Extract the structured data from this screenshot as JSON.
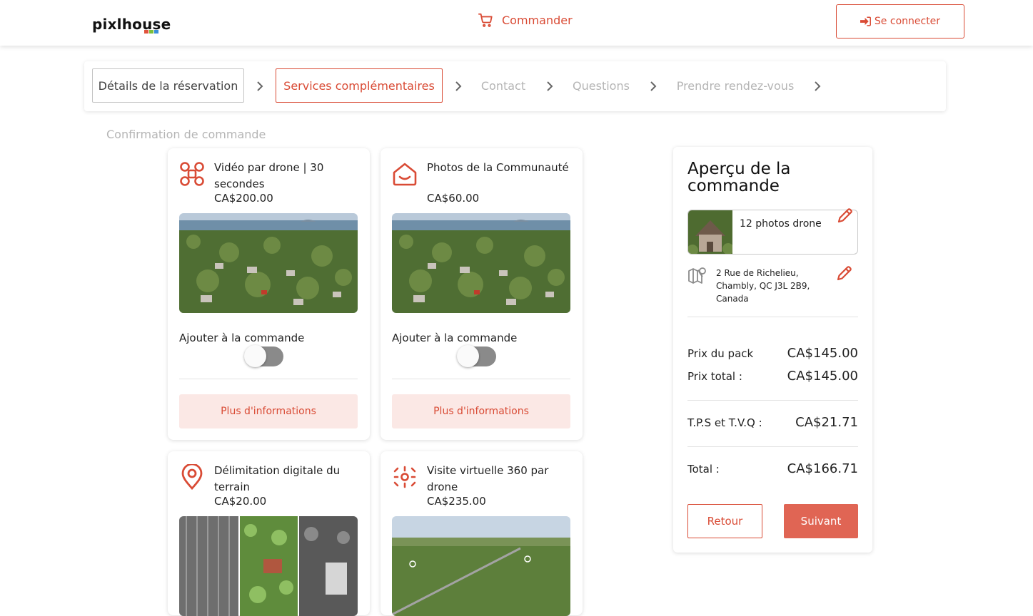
{
  "header": {
    "logo": "pixlhouse",
    "order_label": "Commander",
    "login_label": "Se connecter"
  },
  "colors": {
    "accent": "#d94b35",
    "accent_light": "#fbe8e5",
    "button_primary": "#e06554"
  },
  "stepper": {
    "steps": [
      {
        "label": "Détails de la réservation",
        "state": "done"
      },
      {
        "label": "Services complémentaires",
        "state": "active"
      },
      {
        "label": "Contact",
        "state": "todo"
      },
      {
        "label": "Questions",
        "state": "todo"
      },
      {
        "label": "Prendre rendez-vous",
        "state": "todo"
      }
    ],
    "overflow_step": "Confirmation de commande"
  },
  "services": [
    {
      "icon": "drone-icon",
      "title": "Vidéo par drone | 30 secondes",
      "price": "CA$200.00",
      "add_label": "Ajouter à la commande",
      "enabled": false,
      "more_label": "Plus d'informations"
    },
    {
      "icon": "community-icon",
      "title": "Photos de la Communauté",
      "price": "CA$60.00",
      "add_label": "Ajouter à la commande",
      "enabled": false,
      "more_label": "Plus d'informations"
    },
    {
      "icon": "location-pin-icon",
      "title": "Délimitation digitale du terrain",
      "price": "CA$20.00"
    },
    {
      "icon": "virtual-tour-360-icon",
      "title": "Visite virtuelle 360 par drone",
      "price": "CA$235.00"
    }
  ],
  "summary": {
    "title": "Aperçu de la commande",
    "package_label": "12 photos drone",
    "address": "2 Rue de Richelieu, Chambly, QC J3L 2B9, Canada",
    "pack_price_label": "Prix du pack",
    "pack_price": "CA$145.00",
    "total_price_label": "Prix total :",
    "total_price": "CA$145.00",
    "tax_label": "T.P.S et T.V.Q :",
    "tax": "CA$21.71",
    "grand_total_label": "Total :",
    "grand_total": "CA$166.71",
    "back_label": "Retour",
    "next_label": "Suivant"
  }
}
